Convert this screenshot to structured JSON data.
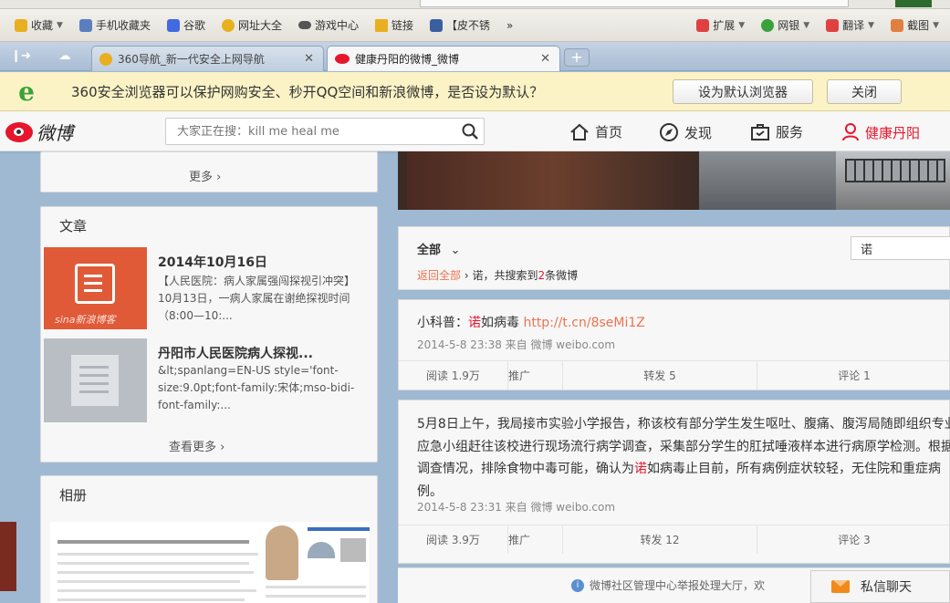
{
  "browser": {
    "bookmarks": [
      {
        "label": "收藏",
        "icon": "star-icon",
        "color": "#e8b020",
        "caret": true
      },
      {
        "label": "手机收藏夹",
        "icon": "phone-icon",
        "color": "#5a7fbf"
      },
      {
        "label": "谷歌",
        "icon": "google-icon",
        "color": "#4169e1"
      },
      {
        "label": "网址大全",
        "icon": "360-icon",
        "color": "#e8b020"
      },
      {
        "label": "游戏中心",
        "icon": "gamepad-icon",
        "color": "#555"
      },
      {
        "label": "链接",
        "icon": "folder-icon",
        "color": "#e8b020"
      },
      {
        "label": "【皮不锈",
        "icon": "bookmark-icon",
        "color": "#3a5f9f"
      },
      {
        "label": "»",
        "icon": "",
        "color": ""
      }
    ],
    "tools": [
      {
        "label": "扩展",
        "icon": "extension-icon",
        "color": "#e04040"
      },
      {
        "label": "网银",
        "icon": "shield-icon",
        "color": "#3aa23a"
      },
      {
        "label": "翻译",
        "icon": "translate-icon",
        "color": "#e04040"
      },
      {
        "label": "截图",
        "icon": "scissors-icon",
        "color": "#e08040"
      }
    ],
    "tabs": [
      {
        "title": "360导航_新一代安全上网导航",
        "active": false
      },
      {
        "title": "健康丹阳的微博_微博",
        "active": true
      }
    ],
    "close_glyph": "✕",
    "new_tab_glyph": "+",
    "infobar": {
      "message": "360安全浏览器可以保护网购安全、秒开QQ空间和新浪微博，是否设为默认？",
      "set_default": "设为默认浏览器",
      "close": "关闭"
    }
  },
  "weibo": {
    "brand": "微博",
    "search_placeholder": "大家正在搜：kill me heal me",
    "nav": {
      "home": "首页",
      "discover": "发现",
      "service": "服务",
      "user": "健康丹阳"
    },
    "left": {
      "more": "更多 ›",
      "articles_heading": "文章",
      "articles": [
        {
          "title": "2014年10月16日",
          "desc": "【人民医院：病人家属强闯探视引冲突】10月13日，一病人家属在谢绝探视时间（8:00—10:..."
        },
        {
          "title": "丹阳市人民医院病人探视...",
          "desc": "&lt;spanlang=EN-US style='font-size:9.0pt;font-family:宋体;mso-bidi-font-family:..."
        }
      ],
      "thumb_watermark": "sina新浪博客",
      "see_more": "查看更多 ›",
      "album_heading": "相册"
    },
    "main": {
      "filter_all": "全部",
      "search_value": "诺",
      "back_all": "返回全部",
      "crumb_sep": " › ",
      "crumb_keyword": "诺",
      "crumb_mid": "，共搜索到",
      "crumb_count": "2",
      "crumb_tail": "条微博",
      "posts": [
        {
          "text_before": "小科普：",
          "text_highlight": "诺",
          "text_after": "如病毒 ",
          "link": "http://t.cn/8seMi1Z",
          "meta": "2014-5-8 23:38 来自 微博 weibo.com",
          "reads": "阅读 1.9万",
          "promote": "推广",
          "reposts": "转发 5",
          "comments": "评论 1"
        },
        {
          "text_before": "5月8日上午，我局接市实验小学报告，称该校有部分学生发生呕吐、腹痛、腹泻局随即组织专业应急小组赶往该校进行现场流行病学调查，采集部分学生的肛拭唾液样本进行病原学检测。根据调查情况，排除食物中毒可能，确认为",
          "text_highlight": "诺",
          "text_after": "如病毒止目前，所有病例症状较轻，无住院和重症病例。",
          "meta": "2014-5-8 23:31 来自 微博 weibo.com",
          "reads": "阅读 3.9万",
          "promote": "推广",
          "reposts": "转发 12",
          "comments": "评论 3"
        }
      ],
      "report_text": "微博社区管理中心举报处理大厅，欢",
      "chat": "私信聊天"
    }
  },
  "colors": {
    "accent": "#e6162d",
    "link": "#eb7350",
    "infobar_bg": "#fbf3c6"
  }
}
